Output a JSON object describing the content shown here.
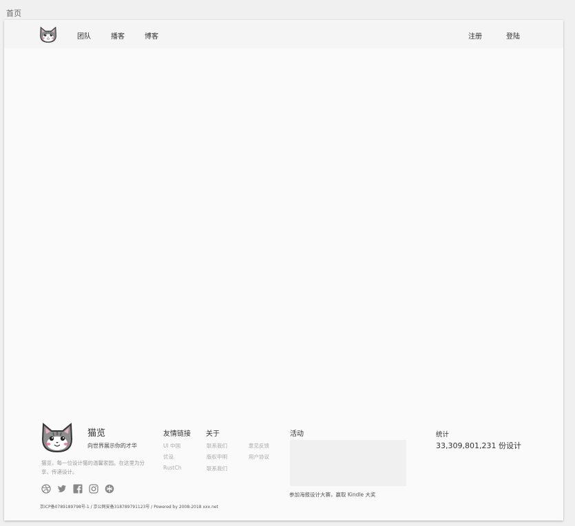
{
  "tab": {
    "title": "首页"
  },
  "nav": {
    "logo_icon": "cat-logo-icon",
    "links": [
      "团队",
      "播客",
      "博客"
    ],
    "register_label": "注册",
    "login_label": "登陆"
  },
  "footer": {
    "brand": {
      "name": "猫览",
      "slogan": "向世界展示你的才华",
      "description": "猫览，每一位设计猫的温馨家园。在这里为分享、传递设计。"
    },
    "social_icons": [
      "dribbble-icon",
      "twitter-icon",
      "facebook-icon",
      "instagram-icon",
      "weibo-icon"
    ],
    "friend_links": {
      "title": "友情链接",
      "items": [
        "UI 中国",
        "优设",
        "RustCh"
      ]
    },
    "about": {
      "title": "关于",
      "col1": [
        "联系我们",
        "版权申明",
        "联系我们"
      ],
      "col2": [
        "意见反馈",
        "用户协议"
      ]
    },
    "activity": {
      "title": "活动",
      "caption": "参加海报设计大赛，赢取 Kindle 大奖"
    },
    "stats": {
      "title": "统计",
      "value": "33,309,801,231 份设计"
    },
    "copyright": "京ICP备07891897​98号-1 / 京公网安备318789791123号 / Powered by 2008-2018 xxx.net"
  },
  "colors": {
    "page_bg": "#f0f0f0",
    "frame_bg": "#fafafa",
    "nav_bg": "#f5f5f5",
    "cat_gray": "#8e8e8e",
    "cat_blush": "#e46a8a"
  }
}
